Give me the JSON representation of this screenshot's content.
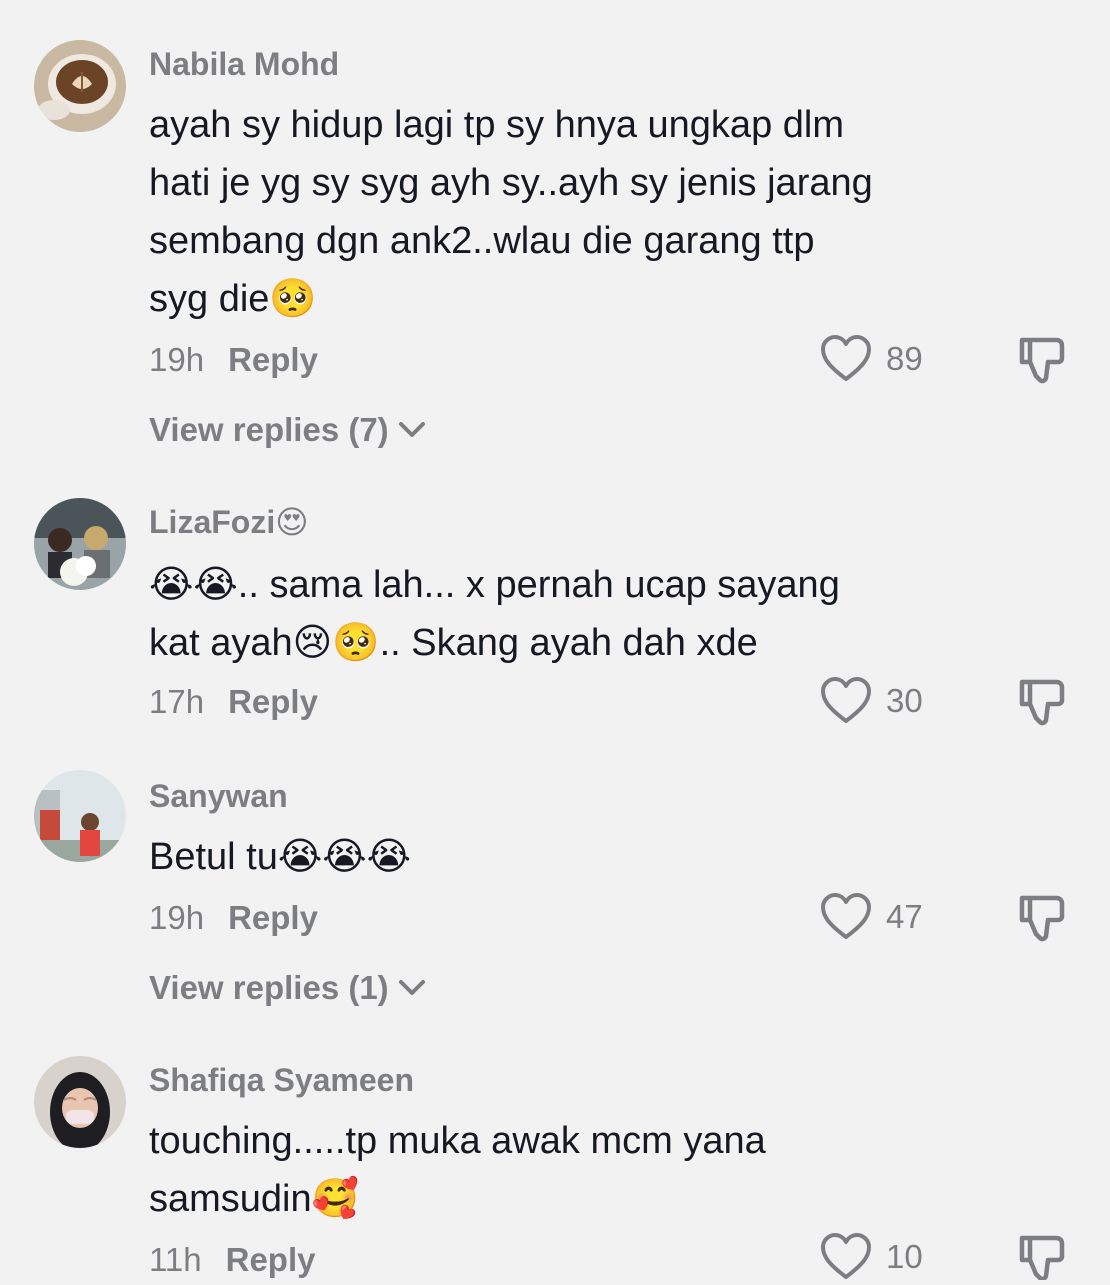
{
  "comments": [
    {
      "username": "Nabila Mohd",
      "text": "ayah sy hidup lagi tp sy hnya ungkap dlm\nhati je yg sy syg ayh sy..ayh sy jenis jarang\nsembang dgn ank2..wlau die garang ttp\nsyg die🥺",
      "time": "19h",
      "reply_label": "Reply",
      "likes": "89",
      "view_replies": "View replies (7)"
    },
    {
      "username": "LizaFozi😍",
      "text": "😭😭.. sama lah... x pernah ucap sayang\nkat ayah😢🥺.. Skang ayah dah xde",
      "time": "17h",
      "reply_label": "Reply",
      "likes": "30"
    },
    {
      "username": "Sanywan",
      "text": "Betul tu😭😭😭",
      "time": "19h",
      "reply_label": "Reply",
      "likes": "47",
      "view_replies": "View replies (1)"
    },
    {
      "username": "Shafiqa Syameen",
      "text": "touching.....tp muka awak mcm yana\nsamsudin🥰",
      "time": "11h",
      "reply_label": "Reply",
      "likes": "10"
    }
  ]
}
